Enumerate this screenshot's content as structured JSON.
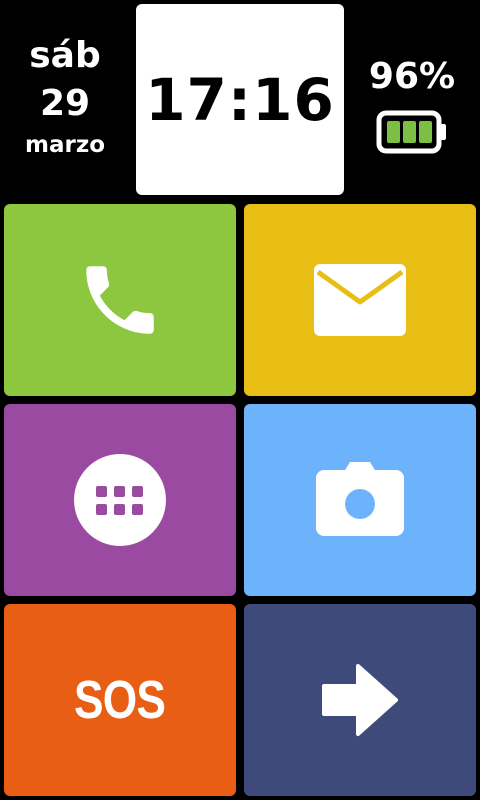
{
  "status_bar": {
    "day_of_week": "sáb",
    "day": "29",
    "month": "marzo",
    "time": "17:16",
    "battery_percent": "96%",
    "battery_level": 0.96,
    "battery_icon": "battery-icon",
    "battery_fill_color": "#7bc043"
  },
  "tiles": [
    {
      "name": "phone",
      "icon": "phone-icon",
      "color": "#8dc63f"
    },
    {
      "name": "messages",
      "icon": "envelope-icon",
      "color": "#e8bd14"
    },
    {
      "name": "apps",
      "icon": "app-grid-icon",
      "color": "#9b4aa1"
    },
    {
      "name": "camera",
      "icon": "camera-icon",
      "color": "#6db3fb"
    },
    {
      "name": "sos",
      "label": "SOS",
      "color": "#e85e14"
    },
    {
      "name": "next",
      "icon": "arrow-right-icon",
      "color": "#3d4a7a"
    }
  ]
}
